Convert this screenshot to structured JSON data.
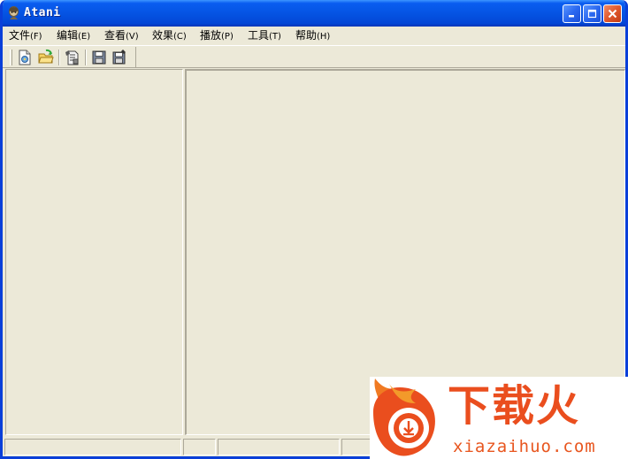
{
  "window": {
    "title": "Atani"
  },
  "menu": [
    {
      "id": "file",
      "label": "文件",
      "accel": "(F)"
    },
    {
      "id": "edit",
      "label": "编辑",
      "accel": "(E)"
    },
    {
      "id": "view",
      "label": "查看",
      "accel": "(V)"
    },
    {
      "id": "effects",
      "label": "效果",
      "accel": "(C)"
    },
    {
      "id": "play",
      "label": "播放",
      "accel": "(P)"
    },
    {
      "id": "tools",
      "label": "工具",
      "accel": "(T)"
    },
    {
      "id": "help",
      "label": "帮助",
      "accel": "(H)"
    }
  ],
  "toolbar": {
    "buttons": [
      {
        "id": "new",
        "icon": "new-document-icon"
      },
      {
        "id": "open",
        "icon": "open-folder-icon"
      },
      {
        "id": "properties",
        "icon": "document-properties-icon"
      },
      {
        "id": "save",
        "icon": "floppy-save-icon"
      },
      {
        "id": "save_as",
        "icon": "floppy-save-as-icon"
      }
    ]
  },
  "watermark": {
    "cn": "下载火",
    "en": "xiazaihuo.com"
  },
  "colors": {
    "titlebar": "#0554e3",
    "face": "#ece9d8",
    "watermark": "#ea4e1e"
  }
}
